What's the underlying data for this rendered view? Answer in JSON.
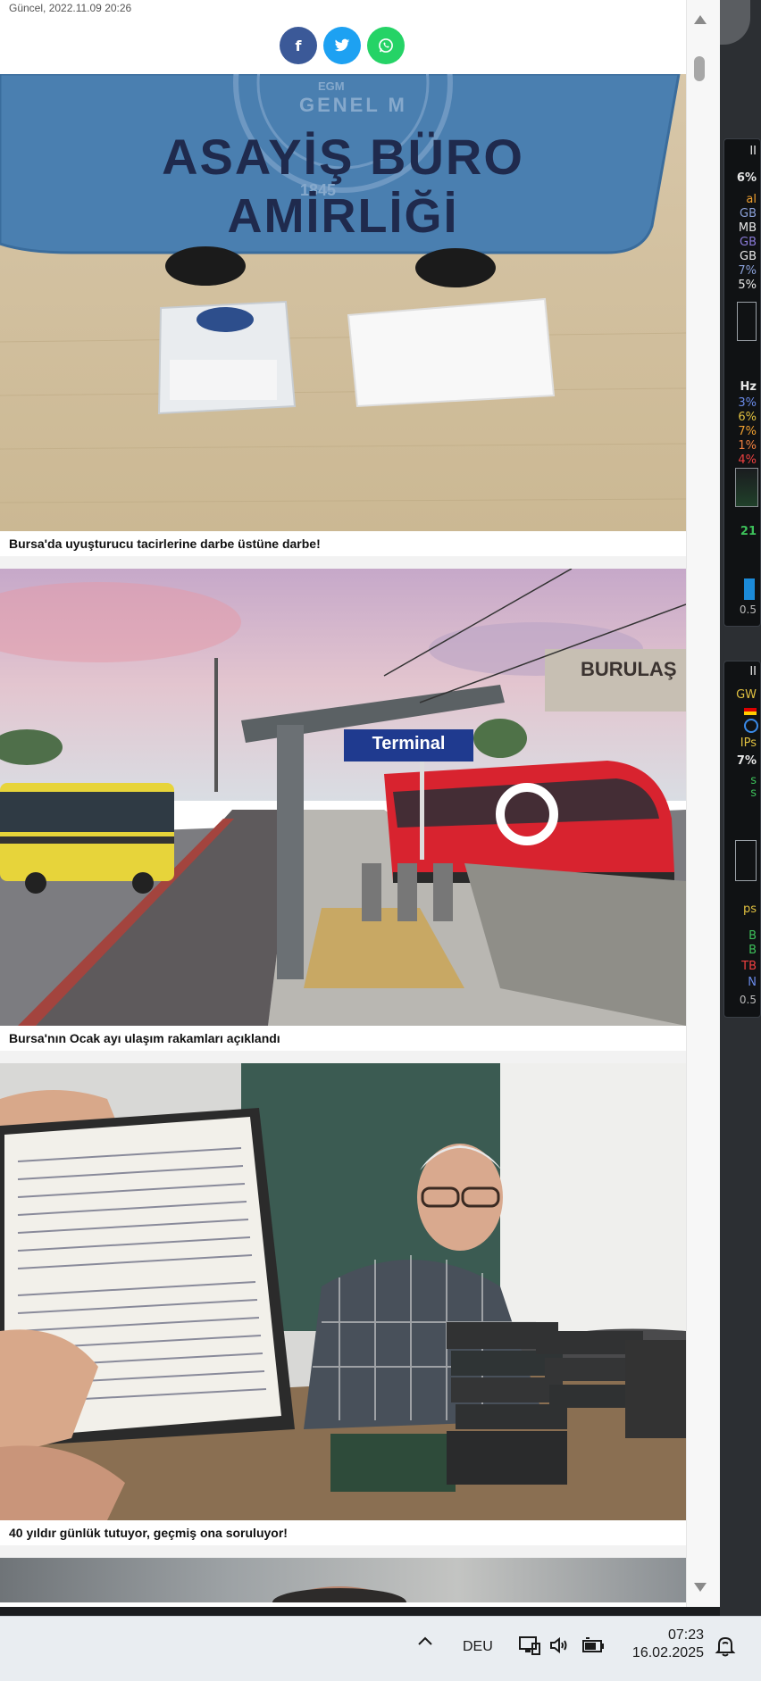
{
  "article_header": {
    "updated": "Güncel, 2022.11.09 20:26",
    "share_buttons": [
      {
        "name": "facebook",
        "glyph": "f",
        "color": "#3b5998"
      },
      {
        "name": "twitter",
        "glyph": "🐦",
        "color": "#1da1f2"
      },
      {
        "name": "whatsapp",
        "glyph": "✆",
        "color": "#25d366"
      }
    ]
  },
  "news": [
    {
      "title": "Bursa'da uyuşturucu tacirlerine darbe üstüne darbe!",
      "image": {
        "sign_line1": "ASAYİŞ BÜRO",
        "sign_line2": "AMİRLİĞİ",
        "seal_top": "GENEL M",
        "seal_mid": "EGM",
        "seal_year": "1845"
      }
    },
    {
      "title": "Bursa'nın Ocak ayı ulaşım rakamları açıklandı",
      "image": {
        "station_sign": "Terminal",
        "company_sign": "BURULAŞ"
      }
    },
    {
      "title": "40 yıldır günlük tutuyor, geçmiş ona soruluyor!",
      "image": {}
    }
  ],
  "gadgets": {
    "panel1": [
      "II",
      "6%",
      "al",
      "GB",
      "MB",
      "GB",
      "GB",
      "7%",
      "5%"
    ],
    "panel1_mid": [
      "Hz",
      "3%",
      "6%",
      "7%",
      "1%",
      "4%"
    ],
    "panel1_low": [
      "21",
      "0.5"
    ],
    "panel2": [
      "II",
      "GW",
      "IPs",
      "7%",
      "s",
      "s"
    ],
    "panel2_low": [
      "ps",
      "B",
      "B",
      "TB",
      "N",
      "0.5"
    ]
  },
  "taskbar": {
    "language": "DEU",
    "time": "07:23",
    "date": "16.02.2025"
  }
}
